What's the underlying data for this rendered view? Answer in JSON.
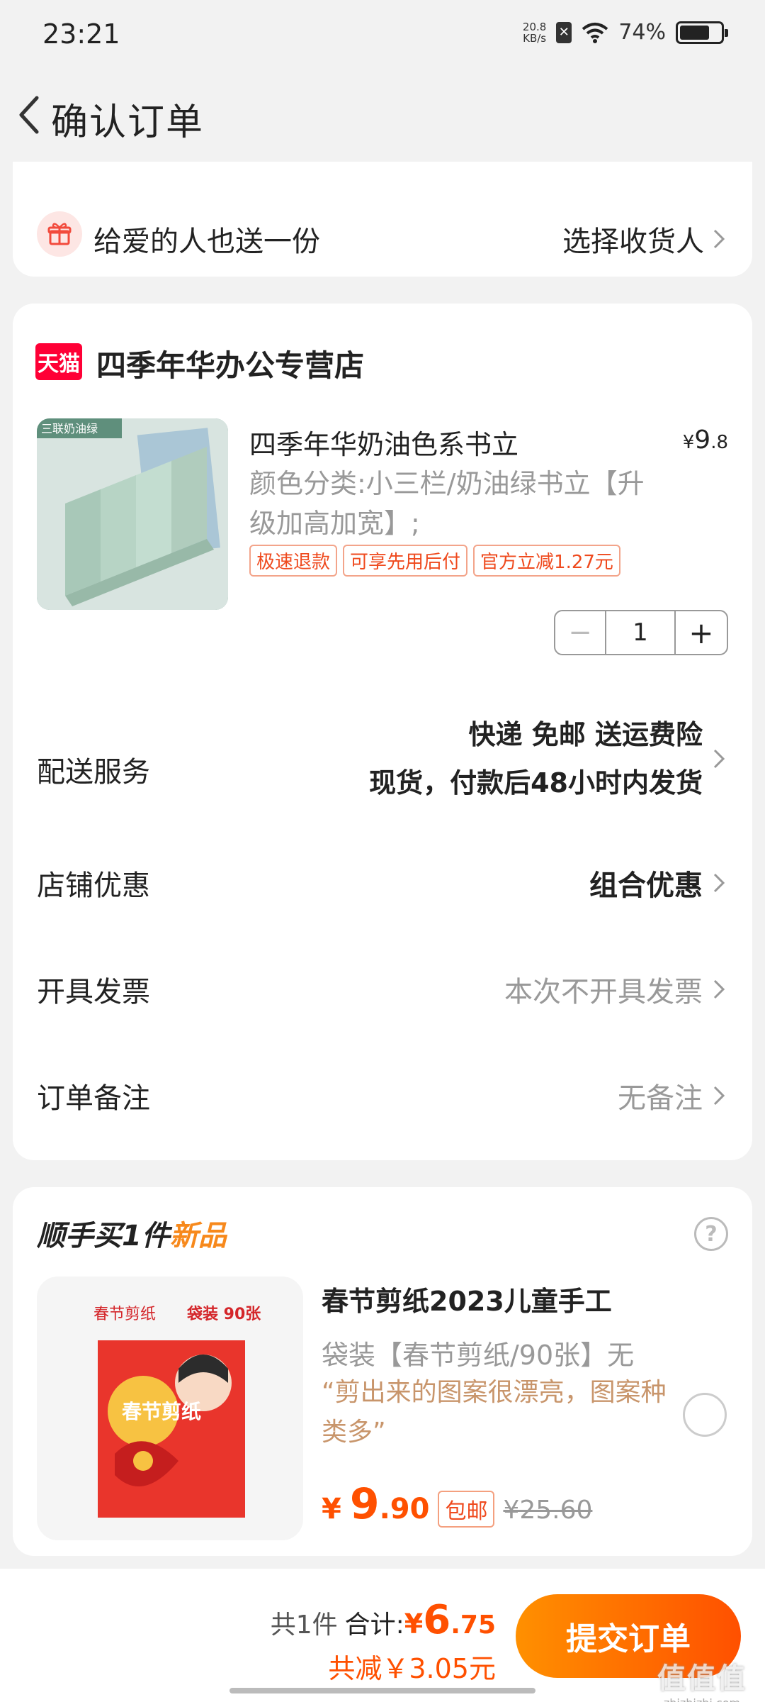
{
  "status_bar": {
    "time": "23:21",
    "net_speed_value": "20.8",
    "net_speed_unit": "KB/s",
    "battery_percent": "74%",
    "battery_level": 0.74
  },
  "header": {
    "title": "确认订单"
  },
  "gift": {
    "label": "给爱的人也送一份",
    "action": "选择收货人"
  },
  "store": {
    "badge": "天猫",
    "name": "四季年华办公专营店"
  },
  "product": {
    "name": "四季年华奶油色系书立",
    "price_symbol": "¥",
    "price_int": "9",
    "price_dec": ".8",
    "spec": "颜色分类:小三栏/奶油绿书立【升级加高加宽】;",
    "tags": [
      "极速退款",
      "可享先用后付",
      "官方立减1.27元"
    ],
    "image_text": "三联奶油绿",
    "quantity": "1",
    "qty_minus": "−",
    "qty_plus": "+"
  },
  "rows": {
    "delivery_label": "配送服务",
    "delivery_line1": "快递 免邮 送运费险",
    "delivery_line2": "现货，付款后48小时内发货",
    "shop_discount_label": "店铺优惠",
    "shop_discount_value": "组合优惠",
    "invoice_label": "开具发票",
    "invoice_value": "本次不开具发票",
    "note_label": "订单备注",
    "note_value": "无备注"
  },
  "addon": {
    "title_prefix": "顺手买1件",
    "title_new": "新品",
    "help": "?",
    "name": "春节剪纸2023儿童手工",
    "spec": "袋装【春节剪纸/90张】无",
    "quote": "“剪出来的图案很漂亮，图案种类多”",
    "image_label_left": "春节剪纸",
    "image_label_right": "袋装 90张",
    "image_cover_text": "春节剪纸",
    "price_symbol": "¥",
    "price_int": "9",
    "price_dec": ".90",
    "shipping_tag": "包邮",
    "old_price": "¥25.60"
  },
  "bottom": {
    "count": "共1件",
    "total_label": "合计:",
    "total_symbol": "¥",
    "total_int": "6",
    "total_dec": ".75",
    "discount": "共减￥3.05元",
    "submit": "提交订单",
    "watermark_top": "值值值",
    "watermark_bottom": "zhizhizhi.com"
  },
  "colors": {
    "accent": "#ff5000",
    "tmall": "#ff0036",
    "background": "#f2f2f2"
  }
}
